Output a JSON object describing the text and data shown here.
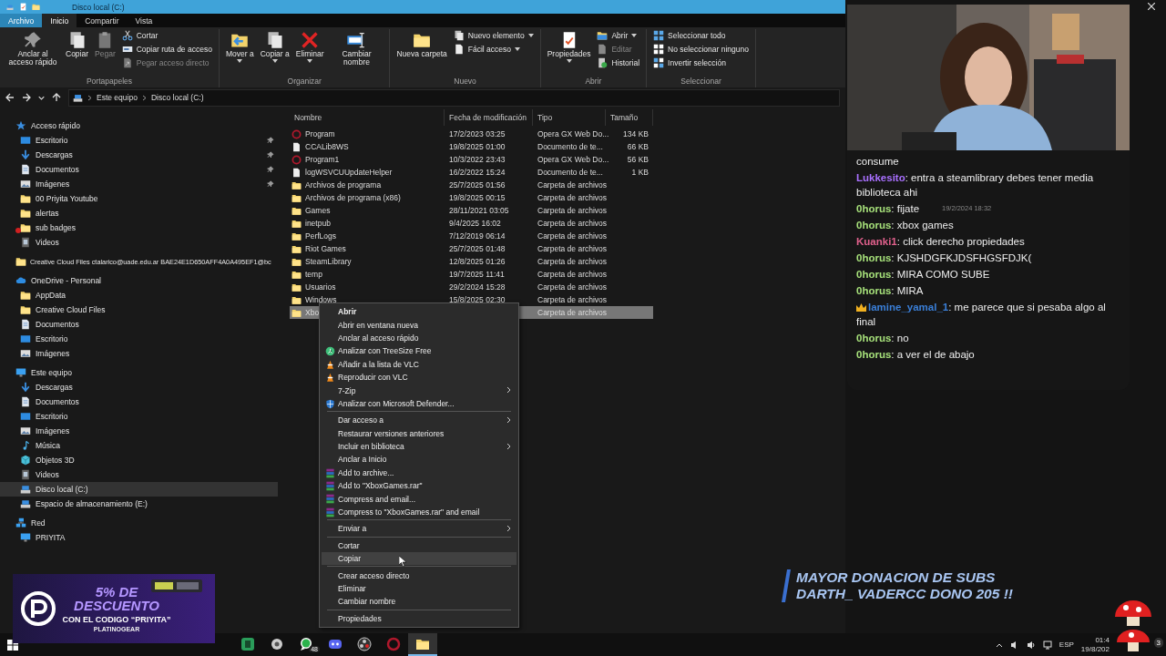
{
  "window": {
    "title": "Disco local (C:)"
  },
  "ribbon": {
    "tabs": [
      {
        "label": "Archivo",
        "kind": "file",
        "selected": false
      },
      {
        "label": "Inicio",
        "kind": "tab",
        "selected": true
      },
      {
        "label": "Compartir",
        "kind": "tab",
        "selected": false
      },
      {
        "label": "Vista",
        "kind": "tab",
        "selected": false
      }
    ],
    "groups": [
      {
        "label": "Portapapeles",
        "large": [
          {
            "label": "Anclar al acceso rápido",
            "disabled": false,
            "dropdown": false
          },
          {
            "label": "Copiar",
            "disabled": false,
            "dropdown": false
          },
          {
            "label": "Pegar",
            "disabled": true,
            "dropdown": false
          }
        ],
        "small": [
          {
            "label": "Cortar",
            "disabled": false,
            "dropdown": false
          },
          {
            "label": "Copiar ruta de acceso",
            "disabled": false,
            "dropdown": false
          },
          {
            "label": "Pegar acceso directo",
            "disabled": true,
            "dropdown": false
          }
        ]
      },
      {
        "label": "Organizar",
        "large": [
          {
            "label": "Mover a",
            "disabled": false,
            "dropdown": true
          },
          {
            "label": "Copiar a",
            "disabled": false,
            "dropdown": true
          },
          {
            "label": "Eliminar",
            "disabled": false,
            "dropdown": true
          },
          {
            "label": "Cambiar nombre",
            "disabled": false,
            "dropdown": false
          }
        ]
      },
      {
        "label": "Nuevo",
        "large": [
          {
            "label": "Nueva carpeta",
            "disabled": false,
            "dropdown": false
          }
        ],
        "small": [
          {
            "label": "Nuevo elemento",
            "disabled": false,
            "dropdown": true
          },
          {
            "label": "Fácil acceso",
            "disabled": false,
            "dropdown": true
          }
        ]
      },
      {
        "label": "Abrir",
        "large": [
          {
            "label": "Propiedades",
            "disabled": false,
            "dropdown": true
          }
        ],
        "small": [
          {
            "label": "Abrir",
            "disabled": false,
            "dropdown": true
          },
          {
            "label": "Editar",
            "disabled": true,
            "dropdown": false
          },
          {
            "label": "Historial",
            "disabled": false,
            "dropdown": false
          }
        ]
      },
      {
        "label": "Seleccionar",
        "small": [
          {
            "label": "Seleccionar todo",
            "disabled": false,
            "dropdown": false
          },
          {
            "label": "No seleccionar ninguno",
            "disabled": false,
            "dropdown": false
          },
          {
            "label": "Invertir selección",
            "disabled": false,
            "dropdown": false
          }
        ]
      }
    ]
  },
  "address": {
    "path": [
      "Este equipo",
      "Disco local (C:)"
    ]
  },
  "sidebar": {
    "items": [
      {
        "label": "Acceso rápido",
        "kind": "star",
        "selected": false,
        "children": [
          {
            "label": "Escritorio",
            "kind": "desktop",
            "selected": false,
            "pinned": true,
            "sync_error": false
          },
          {
            "label": "Descargas",
            "kind": "download",
            "selected": false,
            "pinned": true,
            "sync_error": false
          },
          {
            "label": "Documentos",
            "kind": "docs",
            "selected": false,
            "pinned": true,
            "sync_error": false
          },
          {
            "label": "Imágenes",
            "kind": "images",
            "selected": false,
            "pinned": true,
            "sync_error": false
          },
          {
            "label": "00 Priyita Youtube",
            "kind": "folder",
            "selected": false,
            "pinned": false,
            "sync_error": false
          },
          {
            "label": "alertas",
            "kind": "folder",
            "selected": false,
            "pinned": false,
            "sync_error": false
          },
          {
            "label": "sub badges",
            "kind": "folder",
            "selected": false,
            "pinned": false,
            "sync_error": true
          },
          {
            "label": "Videos",
            "kind": "videos",
            "selected": false,
            "pinned": false,
            "sync_error": false
          }
        ]
      },
      {
        "label": "Creative Cloud Files  ctalarico@uade.edu.ar BAE24E1D650AFF4A0A495EF1@bc",
        "kind": "folder",
        "selected": false
      },
      {
        "label": "OneDrive - Personal",
        "kind": "cloud",
        "selected": false,
        "children": [
          {
            "label": "AppData",
            "kind": "folder",
            "selected": false
          },
          {
            "label": "Creative Cloud Files",
            "kind": "folder",
            "selected": false
          },
          {
            "label": "Documentos",
            "kind": "docs",
            "selected": false
          },
          {
            "label": "Escritorio",
            "kind": "desktop",
            "selected": false
          },
          {
            "label": "Imágenes",
            "kind": "images",
            "selected": false
          }
        ]
      },
      {
        "label": "Este equipo",
        "kind": "pc",
        "selected": false,
        "children": [
          {
            "label": "Descargas",
            "kind": "download",
            "selected": false
          },
          {
            "label": "Documentos",
            "kind": "docs",
            "selected": false
          },
          {
            "label": "Escritorio",
            "kind": "desktop",
            "selected": false
          },
          {
            "label": "Imágenes",
            "kind": "images",
            "selected": false
          },
          {
            "label": "Música",
            "kind": "music",
            "selected": false
          },
          {
            "label": "Objetos 3D",
            "kind": "objects",
            "selected": false
          },
          {
            "label": "Videos",
            "kind": "videos",
            "selected": false
          },
          {
            "label": "Disco local (C:)",
            "kind": "drive",
            "selected": true
          },
          {
            "label": "Espacio de almacenamiento (E:)",
            "kind": "drive",
            "selected": false
          }
        ]
      },
      {
        "label": "Red",
        "kind": "network",
        "selected": false,
        "children": [
          {
            "label": "PRIYITA",
            "kind": "pc",
            "selected": false
          }
        ]
      }
    ]
  },
  "table": {
    "columns": [
      "Nombre",
      "Fecha de modificación",
      "Tipo",
      "Tamaño"
    ],
    "rows": [
      {
        "kind": "opera",
        "name": "Program",
        "date": "17/2/2023 03:25",
        "type": "Opera GX Web Do...",
        "size": "134 KB",
        "selected": false
      },
      {
        "kind": "doc",
        "name": "CCALib8WS",
        "date": "19/8/2025 01:00",
        "type": "Documento de te...",
        "size": "66 KB",
        "selected": false
      },
      {
        "kind": "opera",
        "name": "Program1",
        "date": "10/3/2022 23:43",
        "type": "Opera GX Web Do...",
        "size": "56 KB",
        "selected": false
      },
      {
        "kind": "doc",
        "name": "logWSVCUUpdateHelper",
        "date": "16/2/2022 15:24",
        "type": "Documento de te...",
        "size": "1 KB",
        "selected": false
      },
      {
        "kind": "folder",
        "name": "Archivos de programa",
        "date": "25/7/2025 01:56",
        "type": "Carpeta de archivos",
        "selected": false
      },
      {
        "kind": "folder",
        "name": "Archivos de programa (x86)",
        "date": "19/8/2025 00:15",
        "type": "Carpeta de archivos",
        "selected": false
      },
      {
        "kind": "folder",
        "name": "Games",
        "date": "28/11/2021 03:05",
        "type": "Carpeta de archivos",
        "selected": false
      },
      {
        "kind": "folder",
        "name": "inetpub",
        "date": "9/4/2025 16:02",
        "type": "Carpeta de archivos",
        "selected": false
      },
      {
        "kind": "folder",
        "name": "PerfLogs",
        "date": "7/12/2019 06:14",
        "type": "Carpeta de archivos",
        "selected": false
      },
      {
        "kind": "folder",
        "name": "Riot Games",
        "date": "25/7/2025 01:48",
        "type": "Carpeta de archivos",
        "selected": false
      },
      {
        "kind": "folder",
        "name": "SteamLibrary",
        "date": "12/8/2025 01:26",
        "type": "Carpeta de archivos",
        "selected": false
      },
      {
        "kind": "folder",
        "name": "temp",
        "date": "19/7/2025 11:41",
        "type": "Carpeta de archivos",
        "selected": false
      },
      {
        "kind": "folder",
        "name": "Usuarios",
        "date": "29/2/2024 15:28",
        "type": "Carpeta de archivos",
        "selected": false
      },
      {
        "kind": "folder",
        "name": "Windows",
        "date": "15/8/2025 02:30",
        "type": "Carpeta de archivos",
        "selected": false
      },
      {
        "kind": "folder",
        "name": "Xbo",
        "type": "Carpeta de archivos",
        "selected": true
      }
    ]
  },
  "context_menu": {
    "items": [
      {
        "kind": "default",
        "label": "Abrir",
        "selected": false
      },
      {
        "kind": "item",
        "label": "Abrir en ventana nueva",
        "selected": false
      },
      {
        "kind": "item",
        "label": "Anclar al acceso rápido",
        "selected": false
      },
      {
        "kind": "item",
        "label": "Analizar con TreeSize Free",
        "selected": false
      },
      {
        "kind": "item",
        "label": "Añadir a la lista de VLC",
        "selected": false
      },
      {
        "kind": "item",
        "label": "Reproducir con VLC",
        "selected": false
      },
      {
        "kind": "submenu",
        "label": "7-Zip",
        "selected": false
      },
      {
        "kind": "item",
        "label": "Analizar con Microsoft Defender...",
        "selected": false
      },
      {
        "kind": "separator"
      },
      {
        "kind": "submenu",
        "label": "Dar acceso a",
        "selected": false
      },
      {
        "kind": "item",
        "label": "Restaurar versiones anteriores",
        "selected": false
      },
      {
        "kind": "submenu",
        "label": "Incluir en biblioteca",
        "selected": false
      },
      {
        "kind": "item",
        "label": "Anclar a Inicio",
        "selected": false
      },
      {
        "kind": "item",
        "label": "Add to archive...",
        "selected": false
      },
      {
        "kind": "item",
        "label": "Add to \"XboxGames.rar\"",
        "selected": false
      },
      {
        "kind": "item",
        "label": "Compress and email...",
        "selected": false
      },
      {
        "kind": "item",
        "label": "Compress to \"XboxGames.rar\" and email",
        "selected": false
      },
      {
        "kind": "separator"
      },
      {
        "kind": "submenu",
        "label": "Enviar a",
        "selected": false
      },
      {
        "kind": "separator"
      },
      {
        "kind": "item",
        "label": "Cortar",
        "selected": false
      },
      {
        "kind": "item",
        "label": "Copiar",
        "selected": true
      },
      {
        "kind": "separator"
      },
      {
        "kind": "item",
        "label": "Crear acceso directo",
        "selected": false
      },
      {
        "kind": "item",
        "label": "Eliminar",
        "selected": false
      },
      {
        "kind": "item",
        "label": "Cambiar nombre",
        "selected": false
      },
      {
        "kind": "separator"
      },
      {
        "kind": "item",
        "label": "Propiedades",
        "selected": false
      }
    ]
  },
  "chat": {
    "messages": [
      {
        "kind": "continuation",
        "text": "consume"
      },
      {
        "kind": "message",
        "user": "Lukkesito",
        "color": "#a970ff",
        "badge": false,
        "text": ": entra a steamlibrary debes tener media biblioteca ahi"
      },
      {
        "kind": "message",
        "user": "0horus",
        "color": "#a6e07a",
        "badge": false,
        "text": ": fijate"
      },
      {
        "kind": "message",
        "user": "0horus",
        "color": "#a6e07a",
        "badge": false,
        "text": ": xbox games"
      },
      {
        "kind": "message",
        "user": "Kuanki1",
        "color": "#e0608c",
        "badge": false,
        "text": ": click derecho propiedades"
      },
      {
        "kind": "message",
        "user": "0horus",
        "color": "#a6e07a",
        "badge": false,
        "text": ": KJSHDGFKJDSFHGSFDJK("
      },
      {
        "kind": "message",
        "user": "0horus",
        "color": "#a6e07a",
        "badge": false,
        "text": ": MIRA COMO SUBE"
      },
      {
        "kind": "message",
        "user": "0horus",
        "color": "#a6e07a",
        "badge": false,
        "text": ": MIRA"
      },
      {
        "kind": "message",
        "user": "lamine_yamal_1",
        "color": "#3a7fd8",
        "badge": true,
        "text": ": me parece que si pesaba algo al final"
      },
      {
        "kind": "message",
        "user": "0horus",
        "color": "#a6e07a",
        "badge": false,
        "text": ": no"
      },
      {
        "kind": "message",
        "user": "0horus",
        "color": "#a6e07a",
        "badge": false,
        "text": ": a ver el de abajo"
      }
    ],
    "tooltip": "19/2/2024 18:32"
  },
  "promo": {
    "headline": "5% DE DESCUENTO",
    "code_line": "CON EL CODIGO “PRIYITA”",
    "brand": "PLATINOGEAR"
  },
  "donation": {
    "lines": [
      "MAYOR DONACION DE SUBS",
      "DARTH_ VADERCC DONO 205 !!"
    ]
  },
  "taskbar": {
    "apps": [
      {
        "active": false
      },
      {
        "active": false
      },
      {
        "active": false,
        "badge": "48"
      },
      {
        "active": false
      },
      {
        "active": false
      },
      {
        "active": false
      },
      {
        "active": true
      }
    ],
    "language": "ESP",
    "time": "01:4",
    "date": "19/8/202",
    "notifications": "3"
  }
}
